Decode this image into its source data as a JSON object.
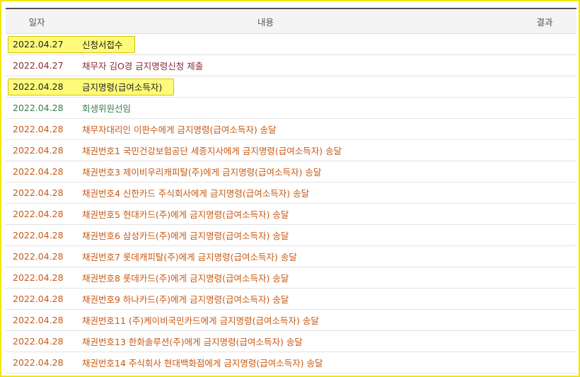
{
  "header": {
    "date": "일자",
    "content": "내용",
    "result": "결과"
  },
  "colors": {
    "black": "#222222",
    "maroon": "#8a2a3a",
    "green": "#3d7a52",
    "orange": "#c85a14"
  },
  "rows": [
    {
      "date": "2022.04.27",
      "content": "신청서접수",
      "tone": "black",
      "highlight": true
    },
    {
      "date": "2022.04.27",
      "content": "채무자 김O경 금지명령신청 제출",
      "tone": "maroon",
      "highlight": false
    },
    {
      "date": "2022.04.28",
      "content": "금지명령(급여소득자)",
      "tone": "black",
      "highlight": true
    },
    {
      "date": "2022.04.28",
      "content": "회생위원선임",
      "tone": "green",
      "highlight": false
    },
    {
      "date": "2022.04.28",
      "content": "채무자대리인 이판수에게 금지명령(급여소득자) 송달",
      "tone": "orange",
      "highlight": false
    },
    {
      "date": "2022.04.28",
      "content": "채권번호1 국민건강보험공단 세종지사에게 금지명령(급여소득자) 송달",
      "tone": "orange",
      "highlight": false
    },
    {
      "date": "2022.04.28",
      "content": "채권번호3 제이비우리캐피탈(주)에게 금지명령(급여소득자) 송달",
      "tone": "orange",
      "highlight": false
    },
    {
      "date": "2022.04.28",
      "content": "채권번호4 신한카드 주식회사에게 금지명령(급여소득자) 송달",
      "tone": "orange",
      "highlight": false
    },
    {
      "date": "2022.04.28",
      "content": "채권번호5 현대카드(주)에게 금지명령(급여소득자) 송달",
      "tone": "orange",
      "highlight": false
    },
    {
      "date": "2022.04.28",
      "content": "채권번호6 삼성카드(주)에게 금지명령(급여소득자) 송달",
      "tone": "orange",
      "highlight": false
    },
    {
      "date": "2022.04.28",
      "content": "채권번호7 롯데캐피탈(주)에게 금지명령(급여소득자) 송달",
      "tone": "orange",
      "highlight": false
    },
    {
      "date": "2022.04.28",
      "content": "채권번호8 롯데카드(주)에게 금지명령(급여소득자) 송달",
      "tone": "orange",
      "highlight": false
    },
    {
      "date": "2022.04.28",
      "content": "채권번호9 하나카드(주)에게 금지명령(급여소득자) 송달",
      "tone": "orange",
      "highlight": false
    },
    {
      "date": "2022.04.28",
      "content": "채권번호11 (주)케이비국민카드에게 금지명령(급여소득자) 송달",
      "tone": "orange",
      "highlight": false
    },
    {
      "date": "2022.04.28",
      "content": "채권번호13 한화솔루션(주)에게 금지명령(급여소득자) 송달",
      "tone": "orange",
      "highlight": false
    },
    {
      "date": "2022.04.28",
      "content": "채권번호14 주식회사 현대백화점에게 금지명령(급여소득자) 송달",
      "tone": "orange",
      "highlight": false
    }
  ]
}
